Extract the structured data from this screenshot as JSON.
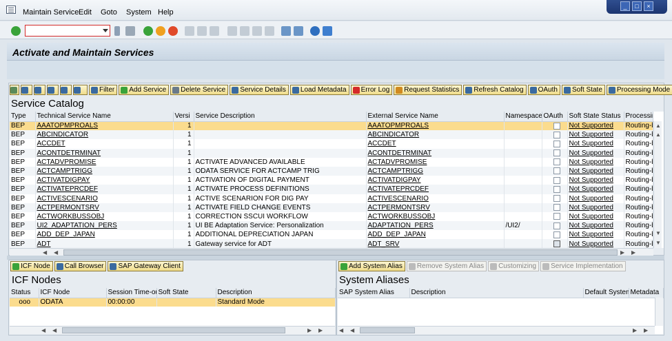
{
  "menu": [
    "Maintain Service",
    "Edit",
    "Goto",
    "System",
    "Help"
  ],
  "window_controls": [
    "_",
    "□",
    "×"
  ],
  "page_title": "Activate and Maintain Services",
  "catalog": {
    "buttons": [
      "Filter",
      "Add Service",
      "Delete Service",
      "Service Details",
      "Load Metadata",
      "Error Log",
      "Request Statistics",
      "Refresh Catalog",
      "OAuth",
      "Soft State",
      "Processing Mode"
    ],
    "title": "Service Catalog",
    "columns": [
      "Type",
      "Technical Service Name",
      "Versi",
      "Service Description",
      "External Service Name",
      "Namespace",
      "OAuth",
      "Soft State Status",
      "Processing"
    ],
    "rows": [
      {
        "type": "BEP",
        "tech": "AAATOPMPROALS",
        "ver": "1",
        "desc": "",
        "ext": "AAATOPMPROALS",
        "ns": "",
        "oauth": false,
        "soft": "Not Supported",
        "proc": "Routing-b"
      },
      {
        "type": "BEP",
        "tech": "ABCINDICATOR",
        "ver": "1",
        "desc": "",
        "ext": "ABCINDICATOR",
        "ns": "",
        "oauth": false,
        "soft": "Not Supported",
        "proc": "Routing-b"
      },
      {
        "type": "BEP",
        "tech": "ACCDET",
        "ver": "1",
        "desc": "",
        "ext": "ACCDET",
        "ns": "",
        "oauth": false,
        "soft": "Not Supported",
        "proc": "Routing-b"
      },
      {
        "type": "BEP",
        "tech": "ACONTDETRMINAT",
        "ver": "1",
        "desc": "",
        "ext": "ACONTDETRMINAT",
        "ns": "",
        "oauth": false,
        "soft": "Not Supported",
        "proc": "Routing-b"
      },
      {
        "type": "BEP",
        "tech": "ACTADVPROMISE",
        "ver": "1",
        "desc": "ACTIVATE ADVANCED AVAILABLE",
        "ext": "ACTADVPROMISE",
        "ns": "",
        "oauth": false,
        "soft": "Not Supported",
        "proc": "Routing-b"
      },
      {
        "type": "BEP",
        "tech": "ACTCAMPTRIGG",
        "ver": "1",
        "desc": "ODATA SERVICE FOR ACTCAMP TRIG",
        "ext": "ACTCAMPTRIGG",
        "ns": "",
        "oauth": false,
        "soft": "Not Supported",
        "proc": "Routing-b"
      },
      {
        "type": "BEP",
        "tech": "ACTIVATDIGPAY",
        "ver": "1",
        "desc": "ACTIVATION OF DIGITAL PAYMENT",
        "ext": "ACTIVATDIGPAY",
        "ns": "",
        "oauth": false,
        "soft": "Not Supported",
        "proc": "Routing-b"
      },
      {
        "type": "BEP",
        "tech": "ACTIVATEPRCDEF",
        "ver": "1",
        "desc": "ACTIVATE PROCESS DEFINITIONS",
        "ext": "ACTIVATEPRCDEF",
        "ns": "",
        "oauth": false,
        "soft": "Not Supported",
        "proc": "Routing-b"
      },
      {
        "type": "BEP",
        "tech": "ACTIVESCENARIO",
        "ver": "1",
        "desc": "ACTIVE SCENARION FOR DIG PAY",
        "ext": "ACTIVESCENARIO",
        "ns": "",
        "oauth": false,
        "soft": "Not Supported",
        "proc": "Routing-b"
      },
      {
        "type": "BEP",
        "tech": "ACTPERMONTSRV",
        "ver": "1",
        "desc": "ACTIVATE FIELD CHANGE EVENTS",
        "ext": "ACTPERMONTSRV",
        "ns": "",
        "oauth": false,
        "soft": "Not Supported",
        "proc": "Routing-b"
      },
      {
        "type": "BEP",
        "tech": "ACTWORKBUSSOBJ",
        "ver": "1",
        "desc": "CORRECTION SSCUI WORKFLOW",
        "ext": "ACTWORKBUSSOBJ",
        "ns": "",
        "oauth": false,
        "soft": "Not Supported",
        "proc": "Routing-b"
      },
      {
        "type": "BEP",
        "tech": "UI2_ADAPTATION_PERS",
        "ver": "1",
        "desc": "UI BE Adaptation Service: Personalization",
        "ext": "ADAPTATION_PERS",
        "ns": "/UI2/",
        "oauth": false,
        "soft": "Not Supported",
        "proc": "Routing-b"
      },
      {
        "type": "BEP",
        "tech": "ADD_DEP_JAPAN",
        "ver": "1",
        "desc": "ADDITIONAL DEPRECIATION JAPAN",
        "ext": "ADD_DEP_JAPAN",
        "ns": "",
        "oauth": false,
        "soft": "Not Supported",
        "proc": "Routing-b"
      },
      {
        "type": "BEP",
        "tech": "ADT",
        "ver": "1",
        "desc": "Gateway service for ADT",
        "ext": "ADT_SRV",
        "ns": "",
        "oauth": true,
        "soft": "Not Supported",
        "proc": "Routing-b"
      }
    ]
  },
  "icf": {
    "buttons": [
      "ICF Node",
      "Call Browser",
      "SAP Gateway Client"
    ],
    "title": "ICF Nodes",
    "columns": [
      "Status",
      "ICF Node",
      "Session Time-out",
      "Soft State",
      "Description"
    ],
    "rows": [
      {
        "status": "ooo",
        "node": "ODATA",
        "timeout": "00:00:00",
        "soft": "",
        "desc": "Standard Mode"
      }
    ]
  },
  "aliases": {
    "buttons": [
      "Add System Alias",
      "Remove System Alias",
      "Customizing",
      "Service Implementation"
    ],
    "title": "System Aliases",
    "columns": [
      "SAP System Alias",
      "Description",
      "Default System",
      "Metadata"
    ]
  },
  "colors": {
    "selected_row": "#fbdc8e",
    "button_bg": "#f0dc8a",
    "header_bg": "#e7ecf1"
  }
}
